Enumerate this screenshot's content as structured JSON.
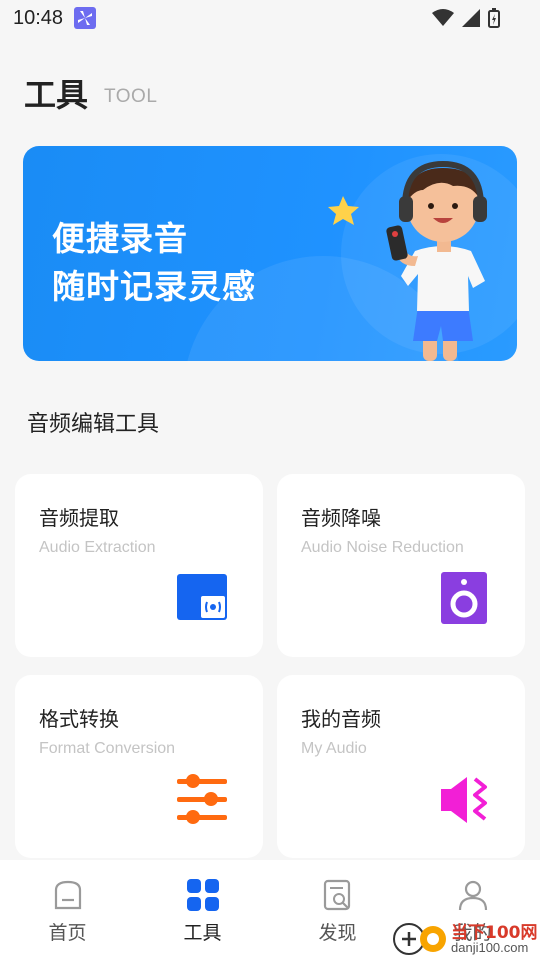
{
  "status": {
    "time": "10:48"
  },
  "header": {
    "title": "工具",
    "subtitle": "TOOL"
  },
  "banner": {
    "line1": "便捷录音",
    "line2": "随时记录灵感"
  },
  "section": {
    "title": "音频编辑工具"
  },
  "cards": [
    {
      "title": "音频提取",
      "subtitle": "Audio Extraction",
      "icon": "audio-extraction-icon",
      "color": "#1565f0"
    },
    {
      "title": "音频降噪",
      "subtitle": "Audio Noise Reduction",
      "icon": "speaker-icon",
      "color": "#8a3ee0"
    },
    {
      "title": "格式转换",
      "subtitle": "Format Conversion",
      "icon": "sliders-icon",
      "color": "#ff6a10"
    },
    {
      "title": "我的音频",
      "subtitle": "My Audio",
      "icon": "volume-icon",
      "color": "#f21fd6"
    }
  ],
  "tabs": [
    {
      "label": "首页",
      "icon": "home-icon",
      "active": false
    },
    {
      "label": "工具",
      "icon": "grid-icon",
      "active": true
    },
    {
      "label": "发现",
      "icon": "discover-icon",
      "active": false
    },
    {
      "label": "我的",
      "icon": "user-icon",
      "active": false
    }
  ],
  "watermark": {
    "line1": "当下100网",
    "line2": "danji100.com"
  },
  "colors": {
    "accent": "#1f8df7",
    "background": "#f6f6f6"
  }
}
